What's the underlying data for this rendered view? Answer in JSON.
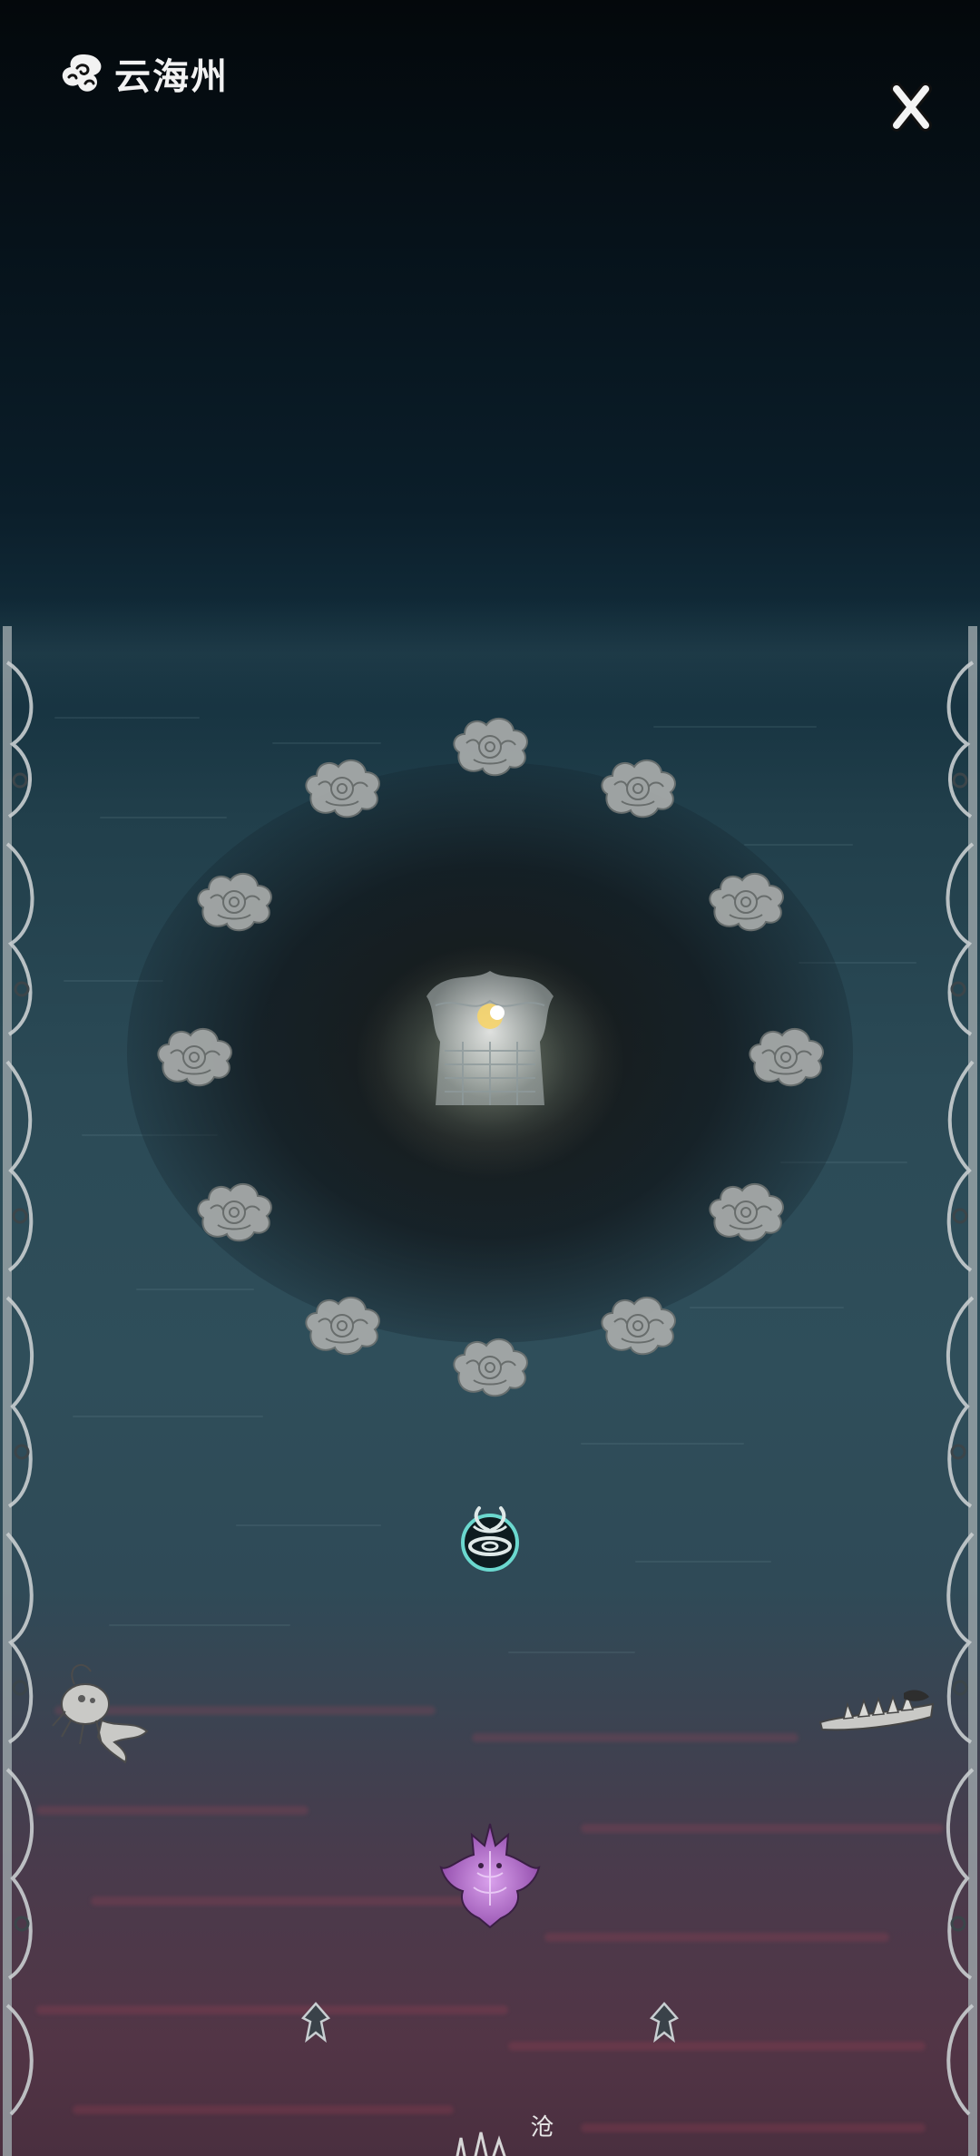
{
  "header": {
    "title": "云海州",
    "logo_icon": "auspicious-cloud-icon",
    "close_icon": "close-x-icon"
  },
  "map": {
    "cloud_islands": [
      {
        "id": 1,
        "icon": "cloud-island-icon",
        "state": "locked"
      },
      {
        "id": 2,
        "icon": "cloud-island-icon",
        "state": "locked"
      },
      {
        "id": 3,
        "icon": "cloud-island-icon",
        "state": "locked"
      },
      {
        "id": 4,
        "icon": "cloud-island-icon",
        "state": "locked"
      },
      {
        "id": 5,
        "icon": "cloud-island-icon",
        "state": "locked"
      },
      {
        "id": 6,
        "icon": "cloud-island-icon",
        "state": "locked"
      },
      {
        "id": 7,
        "icon": "cloud-island-icon",
        "state": "locked"
      },
      {
        "id": 8,
        "icon": "cloud-island-icon",
        "state": "locked"
      },
      {
        "id": 9,
        "icon": "cloud-island-icon",
        "state": "locked"
      },
      {
        "id": 10,
        "icon": "cloud-island-icon",
        "state": "locked"
      },
      {
        "id": 11,
        "icon": "cloud-island-icon",
        "state": "locked"
      },
      {
        "id": 12,
        "icon": "cloud-island-icon",
        "state": "locked"
      }
    ],
    "center": {
      "icon": "glowing-citadel-icon"
    },
    "portal": {
      "icon": "vortex-portal-icon"
    },
    "crab": {
      "icon": "sea-crab-icon"
    },
    "shipwreck": {
      "icon": "spiked-shipwreck-icon"
    },
    "dragon": {
      "icon": "purple-dragon-icon"
    },
    "markers": [
      {
        "icon": "waypoint-marker-icon"
      },
      {
        "icon": "waypoint-marker-icon"
      }
    ],
    "place_label": "沧海"
  },
  "colors": {
    "sky": "#05090d",
    "sea": "#2f4e5a",
    "red_tide": "#523546",
    "dragon": "#b06ac8",
    "portal_glow": "#6fe0d6",
    "citadel_glow": "#f3e9b0"
  }
}
